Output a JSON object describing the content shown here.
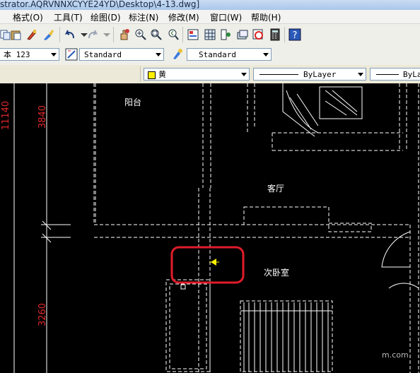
{
  "window": {
    "title": "strator.AQRVNNXCYYE24YD\\Desktop\\4-13.dwg]"
  },
  "menu": {
    "items": [
      "格式(O)",
      "工具(T)",
      "绘图(D)",
      "标注(N)",
      "修改(M)",
      "窗口(W)",
      "帮助(H)"
    ]
  },
  "toolbar2": {
    "text_style_value": "本 123",
    "dim_style_value": "Standard",
    "table_style_value": "Standard"
  },
  "toolbar3": {
    "color_value": "黄",
    "linetype_value": "ByLayer",
    "lineweight_value": "ByLa"
  },
  "drawing": {
    "dimensions": {
      "total": "11140",
      "upper": "3840",
      "lower": "3260"
    },
    "rooms": {
      "balcony": "阳台",
      "living": "客厅",
      "bedroom": "次卧室"
    },
    "watermark": "m.com"
  },
  "colors": {
    "dim_red": "#e0282a",
    "highlight_red": "#e01c2a",
    "cursor_yellow": "#ffee00",
    "line_white": "#ffffff"
  }
}
